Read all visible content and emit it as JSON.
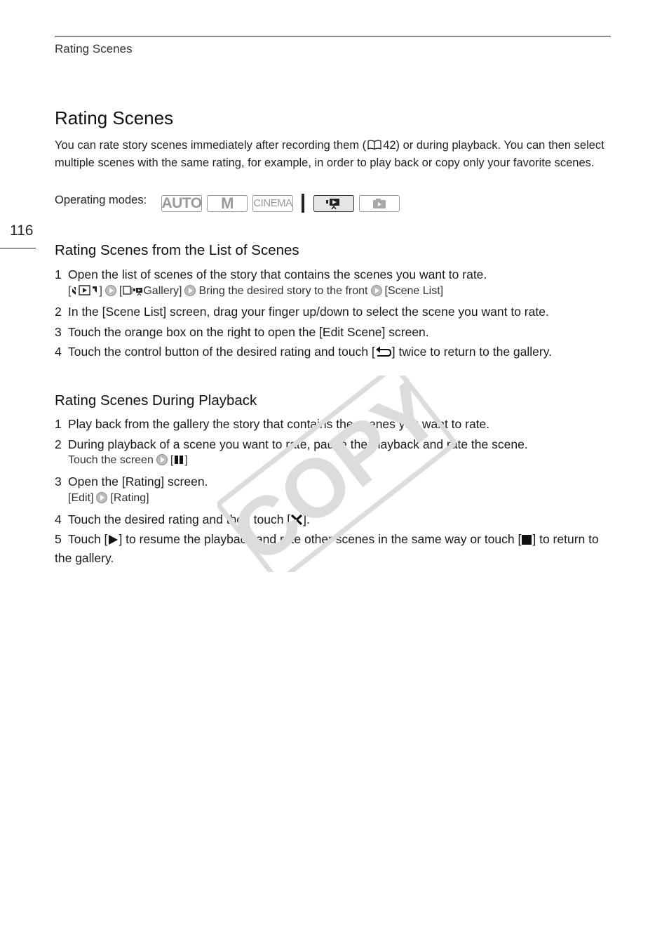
{
  "header": {
    "running_head": "Rating Scenes"
  },
  "page_number": "116",
  "title": "Rating Scenes",
  "intro": {
    "before_ref": "You can rate story scenes immediately after recording them (",
    "ref_icon": "book-icon",
    "ref_page": "42",
    "after_ref": ") or during playback. You can then select multiple scenes with the same rating, for example, in order to play back or copy only your favorite scenes."
  },
  "operating_modes": {
    "label": "Operating modes:",
    "modes": [
      {
        "label": "AUTO",
        "active": false
      },
      {
        "label": "M",
        "active": false
      },
      {
        "label": "CINEMA",
        "active": false
      },
      {
        "label": "movie-playback-icon",
        "active": true
      },
      {
        "label": "photo-playback-icon",
        "active": false
      }
    ]
  },
  "section1": {
    "heading": "Rating Scenes from the List of Scenes",
    "steps": [
      {
        "num": "1",
        "text": "Open the list of scenes of the story that contains the scenes you want to rate."
      },
      {
        "num": "2",
        "text": "In the [Scene List] screen, drag your finger up/down to select the scene you want to rate."
      },
      {
        "num": "3",
        "text": "Touch the orange box on the right to open the [Edit Scene] screen."
      },
      {
        "num": "4",
        "text_before": "Touch the control button of the desired rating and touch [",
        "text_after": "] twice to return to the gallery."
      }
    ],
    "sub1": {
      "bracket_open": "[",
      "bracket_close": "]",
      "gallery": "Gallery]",
      "gallery_open": "[",
      "bring": "Bring the desired story to the front",
      "scene_list": "[Scene List]"
    }
  },
  "section2": {
    "heading": "Rating Scenes During Playback",
    "steps": [
      {
        "num": "1",
        "text": "Play back from the gallery the story that contains the scenes you want to rate."
      },
      {
        "num": "2",
        "text": "During playback of a scene you want to rate, pause the playback and rate the scene."
      },
      {
        "num": "3",
        "text": "Open the [Rating] screen."
      },
      {
        "num": "4",
        "text_before": "Touch the desired rating and then touch [",
        "text_after": "]."
      },
      {
        "num": "5",
        "text_before": "Touch [",
        "text_mid": "] to resume the playback and rate other scenes in the same way or touch [",
        "text_after": "] to return to the gallery."
      }
    ],
    "sub2": {
      "touch": "Touch the screen",
      "pause_open": "[",
      "pause_close": "]"
    },
    "sub3": {
      "edit": "[Edit]",
      "rating": "[Rating]"
    }
  },
  "watermark": "COPY",
  "colors": {
    "text": "#1a1a1a",
    "watermark": "#dcdcdc",
    "mode_inactive": "#9a9a9a"
  }
}
